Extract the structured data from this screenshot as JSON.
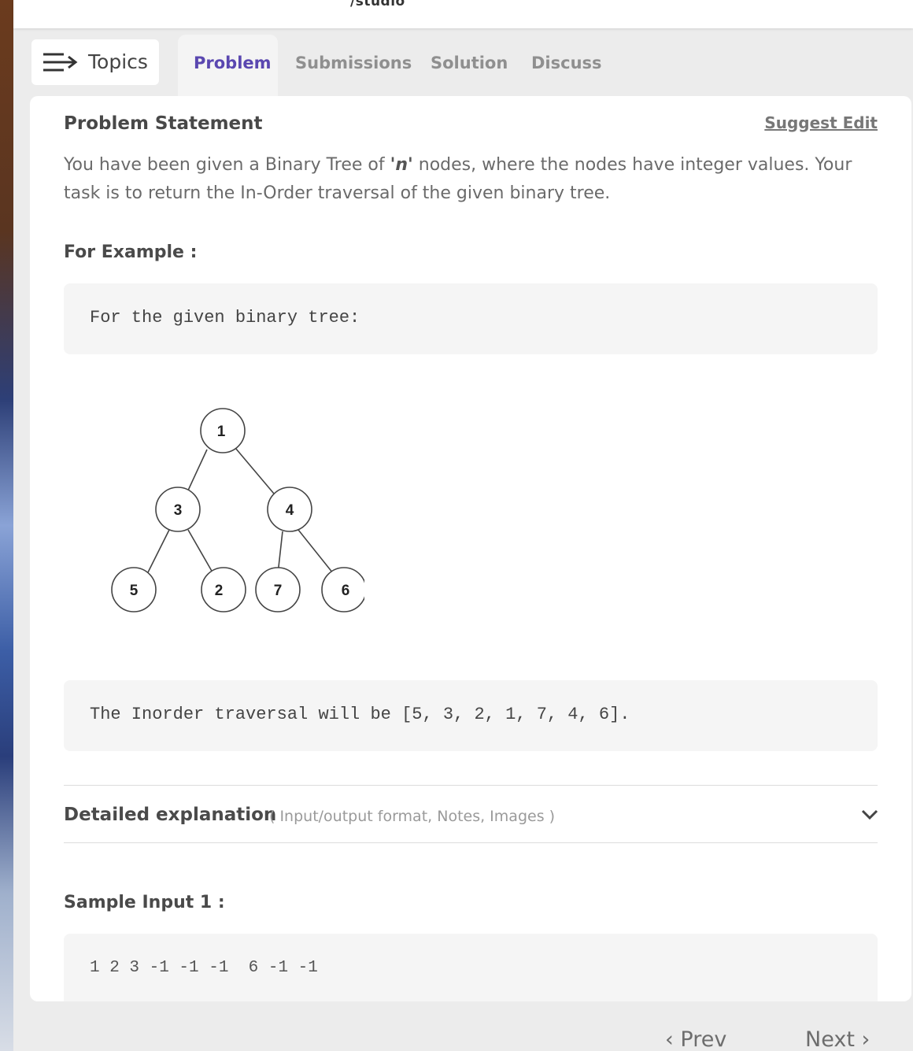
{
  "header": {
    "crumb": "/studio"
  },
  "topics": {
    "label": "Topics",
    "icon": "menu-arrow-icon"
  },
  "tabs": [
    {
      "label": "Problem",
      "active": true
    },
    {
      "label": "Submissions",
      "active": false
    },
    {
      "label": "Solution",
      "active": false
    },
    {
      "label": "Discuss",
      "active": false
    }
  ],
  "problem": {
    "title": "Problem Statement",
    "suggest_edit": "Suggest Edit",
    "statement_pre": "You have been given a Binary Tree of ",
    "statement_var": "'n'",
    "statement_post": " nodes, where the nodes have integer values. Your task is to return the In-Order traversal of the given binary tree.",
    "example_heading": "For Example :",
    "example_code": "For the given binary tree:",
    "tree_nodes": [
      "1",
      "3",
      "4",
      "5",
      "2",
      "7",
      "6"
    ],
    "result_code": "The Inorder traversal will be [5, 3, 2, 1, 7, 4, 6].",
    "detailed_title": "Detailed explanation",
    "detailed_sub": "( Input/output format, Notes, Images )",
    "sample_heading": "Sample Input 1 :",
    "sample_input": "1 2 3 -1 -1 -1  6 -1 -1"
  },
  "pager": {
    "prev": "Prev",
    "next": "Next"
  },
  "colors": {
    "accent": "#5a47b0",
    "card": "#ffffff",
    "code_bg": "#f5f5f5"
  }
}
